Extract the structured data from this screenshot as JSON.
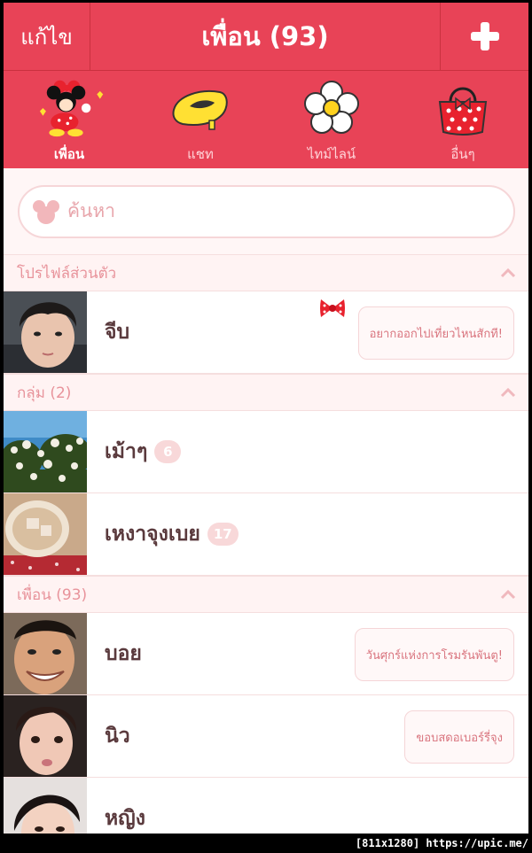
{
  "header": {
    "edit": "แก้ไข",
    "title": "เพื่อน (93)"
  },
  "tabs": [
    {
      "label": "เพื่อน",
      "icon": "minnie-mouse-icon",
      "active": true
    },
    {
      "label": "แชท",
      "icon": "yellow-shoe-icon"
    },
    {
      "label": "ไทม์ไลน์",
      "icon": "flower-icon"
    },
    {
      "label": "อื่นๆ",
      "icon": "red-polka-dot-bag-icon"
    }
  ],
  "search": {
    "placeholder": "ค้นหา"
  },
  "sections": {
    "profile": {
      "title": "โปรไฟล์ส่วนตัว"
    },
    "groups": {
      "title": "กลุ่ม (2)"
    },
    "friends": {
      "title": "เพื่อน (93)"
    }
  },
  "profile": {
    "name": "จีบ",
    "status": "อยากออกไปเที่ยวไหนสักที!"
  },
  "groups": [
    {
      "name": "เม้าๆ",
      "count": "6"
    },
    {
      "name": "เหงาจุงเบย",
      "count": "17"
    }
  ],
  "friends": [
    {
      "name": "บอย",
      "status": "วันศุกร์แห่งการโรมรันพันตู!"
    },
    {
      "name": "นิว",
      "status": "ขอบสดอเบอร์รี่จุง"
    },
    {
      "name": "หญิง"
    }
  ],
  "colors": {
    "brand": "#e84357",
    "section_bg": "#fff3f3",
    "section_text": "#e8939b"
  },
  "watermark": "[811x1280] https://upic.me/"
}
